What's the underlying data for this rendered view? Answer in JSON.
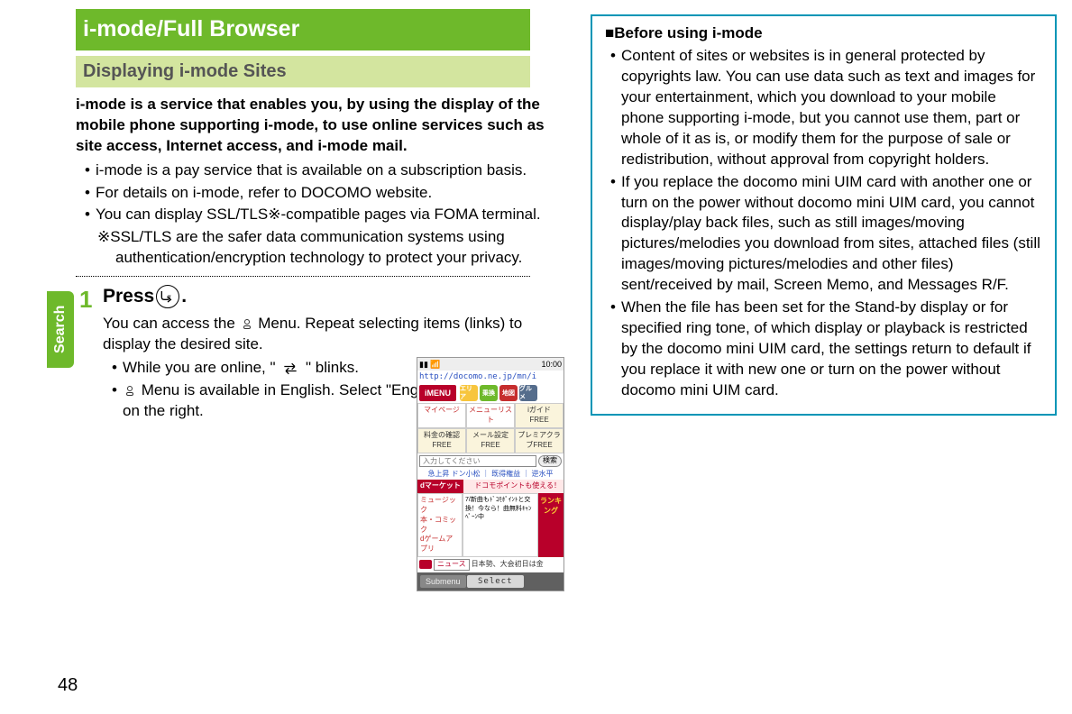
{
  "pageNumber": "48",
  "sideTab": "Search",
  "left": {
    "mainTitle": "i-mode/Full Browser",
    "subTitle": "Displaying i-mode Sites",
    "intro": "i-mode is a service that enables you, by using the display of the mobile phone supporting i-mode, to use online services such as site access, Internet access, and i-mode mail.",
    "bullets": [
      "i-mode is a pay service that is available on a subscription basis.",
      "For details on i-mode, refer to DOCOMO website.",
      "You can display SSL/TLS※-compatible pages via FOMA terminal."
    ],
    "note": "※SSL/TLS are the safer data communication systems using authentication/encryption technology to protect your privacy.",
    "step": {
      "num": "1",
      "pressPrefix": "Press ",
      "pressSuffix": ".",
      "desc1a": "You can access the ",
      "desc1b": "Menu. Repeat selecting items (links) to display the desired site.",
      "sub1a": "While you are online, \"",
      "sub1b": "\" blinks.",
      "sub2a": "",
      "sub2b": "Menu is available in English. Select \"English\" from the display on the right."
    }
  },
  "phone": {
    "time": "10:00",
    "url": "http://docomo.ne.jp/mn/i",
    "imenu": "iMENU",
    "cats": [
      "エリア",
      "乗換",
      "地図",
      "グルメ"
    ],
    "row1": [
      "マイページ",
      "メニューリスト",
      "iガイド FREE"
    ],
    "row2": [
      "料金の確認FREE",
      "メール設定FREE",
      "プレミアクラブFREE"
    ],
    "searchPlaceholder": "入力してください",
    "searchBtn": "検索",
    "links": "急上昇 ドン小松 ｜ 既得権益 ｜ 逆水平",
    "dLeft": "dマーケット",
    "dRight": "ドコモポイントも使える！",
    "rankLeft1": "ミュージック",
    "rankLeft2": "本・コミック",
    "rankLeft3": "dゲームアプリ",
    "rankMid": "7/新曲もﾄﾞｺﾓﾎﾟｲﾝﾄと交換！今なら！曲無料ｷｬﾝﾍﾟｰﾝ中",
    "rankRight": "ランキング",
    "newsLabel": "ニュース",
    "newsText": "日本勢、大会初日は金",
    "submenu": "Submenu",
    "select": "Select"
  },
  "right": {
    "heading": "Before using i-mode",
    "bullets": [
      "Content of sites or websites is in general protected by copyrights law. You can use data such as text and images for your entertainment, which you download to your mobile phone supporting i-mode, but you cannot use them, part or whole of it as is, or modify them for the purpose of sale or redistribution, without approval from copyright holders.",
      "If you replace the docomo mini UIM card with another one or turn on the power without docomo mini UIM card, you cannot display/play back files, such as still images/moving pictures/melodies you download from sites, attached files (still images/moving pictures/melodies and other files) sent/received by mail, Screen Memo, and Messages R/F.",
      "When the file has been set for the Stand-by display or for specified ring tone, of which display or playback is restricted by the docomo mini UIM card, the settings return to default if you replace it with new one or turn on the power without docomo mini UIM card."
    ]
  }
}
